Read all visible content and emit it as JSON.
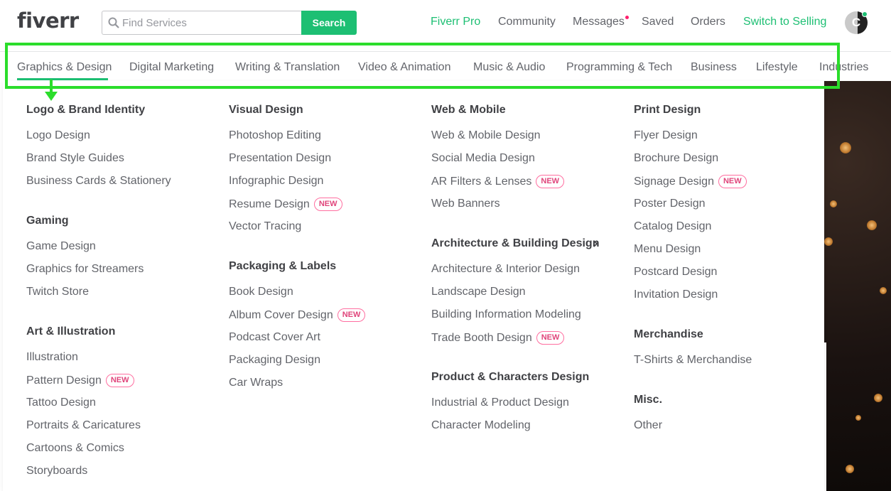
{
  "header": {
    "logo": "fiverr",
    "search_placeholder": "Find Services",
    "search_button": "Search",
    "nav": {
      "fiverr_pro": "Fiverr Pro",
      "community": "Community",
      "messages": "Messages",
      "saved": "Saved",
      "orders": "Orders",
      "switch_selling": "Switch to Selling"
    },
    "avatar_letter": "C"
  },
  "categories": [
    "Graphics & Design",
    "Digital Marketing",
    "Writing & Translation",
    "Video & Animation",
    "Music & Audio",
    "Programming & Tech",
    "Business",
    "Lifestyle",
    "Industries"
  ],
  "menu": {
    "new_badge": "NEW",
    "col1": {
      "g1_title": "Logo & Brand Identity",
      "g1_items": [
        "Logo Design",
        "Brand Style Guides",
        "Business Cards & Stationery"
      ],
      "g2_title": "Gaming",
      "g2_items": [
        "Game Design",
        "Graphics for Streamers",
        "Twitch Store"
      ],
      "g3_title": "Art & Illustration",
      "g3_items": [
        "Illustration",
        "Pattern Design",
        "Tattoo Design",
        "Portraits & Caricatures",
        "Cartoons & Comics",
        "Storyboards"
      ]
    },
    "col2": {
      "g1_title": "Visual Design",
      "g1_items": [
        "Photoshop Editing",
        "Presentation Design",
        "Infographic Design",
        "Resume Design",
        "Vector Tracing"
      ],
      "g2_title": "Packaging & Labels",
      "g2_items": [
        "Book Design",
        "Album Cover Design",
        "Podcast Cover Art",
        "Packaging Design",
        "Car Wraps"
      ]
    },
    "col3": {
      "g1_title": "Web & Mobile",
      "g1_items": [
        "Web & Mobile Design",
        "Social Media Design",
        "AR Filters & Lenses",
        "Web Banners"
      ],
      "g2_title": "Architecture & Building Design",
      "g2_items": [
        "Architecture & Interior Design",
        "Landscape Design",
        "Building Information Modeling",
        "Trade Booth Design"
      ],
      "g3_title": "Product & Characters Design",
      "g3_items": [
        "Industrial & Product Design",
        "Character Modeling"
      ]
    },
    "col4": {
      "g1_title": "Print Design",
      "g1_items": [
        "Flyer Design",
        "Brochure Design",
        "Signage Design",
        "Poster Design",
        "Catalog Design",
        "Menu Design",
        "Postcard Design",
        "Invitation Design"
      ],
      "g2_title": "Merchandise",
      "g2_items": [
        "T-Shirts & Merchandise"
      ],
      "g3_title": "Misc.",
      "g3_items": [
        "Other"
      ]
    }
  },
  "colors": {
    "brand_green": "#1dbf73",
    "highlight_green": "#2bdd2b",
    "new_pink": "#e0457b"
  }
}
